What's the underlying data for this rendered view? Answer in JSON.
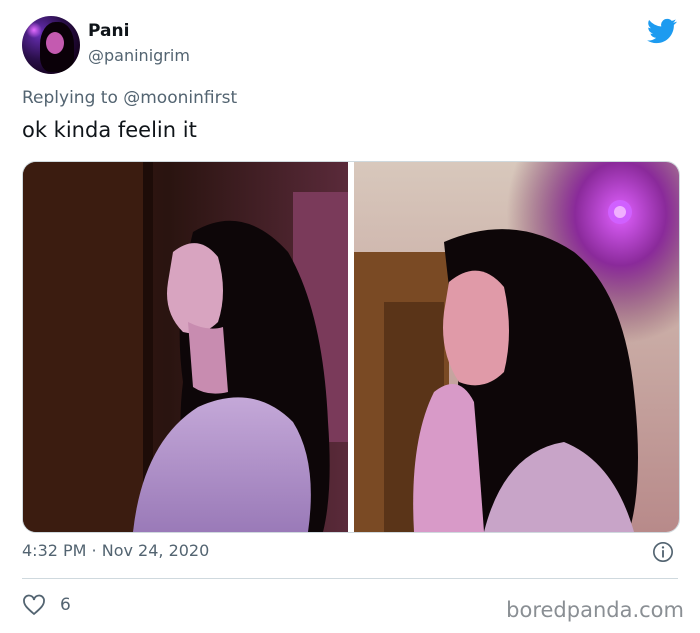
{
  "author": {
    "display_name": "Pani",
    "handle": "@paninigrim"
  },
  "reply": {
    "prefix": "Replying to ",
    "target": "@mooninfirst"
  },
  "tweet": {
    "text": "ok kinda feelin it",
    "timestamp": "4:32 PM · Nov 24, 2020",
    "likes": "6"
  },
  "icons": {
    "brand": "twitter-bird-icon",
    "info": "info-icon",
    "like": "heart-icon"
  },
  "colors": {
    "brand": "#1d9bf0",
    "text": "#0f1419",
    "secondary": "#536471"
  },
  "watermark": "boredpanda.com"
}
